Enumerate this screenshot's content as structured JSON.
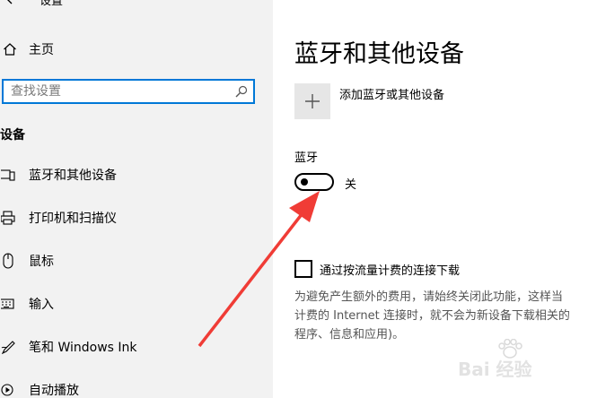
{
  "sidebar": {
    "header": "设置",
    "home_label": "主页",
    "search_placeholder": "查找设置",
    "section_title": "设备",
    "items": [
      {
        "label": "蓝牙和其他设备",
        "icon": "bluetooth-devices-icon"
      },
      {
        "label": "打印机和扫描仪",
        "icon": "printer-icon"
      },
      {
        "label": "鼠标",
        "icon": "mouse-icon"
      },
      {
        "label": "输入",
        "icon": "keyboard-icon"
      },
      {
        "label": "笔和 Windows Ink",
        "icon": "pen-icon"
      },
      {
        "label": "自动播放",
        "icon": "autoplay-icon"
      }
    ]
  },
  "main": {
    "title": "蓝牙和其他设备",
    "add_device_label": "添加蓝牙或其他设备",
    "bluetooth_label": "蓝牙",
    "bluetooth_state": "关",
    "metered_label": "通过按流量计费的连接下载",
    "metered_description": [
      "为避免产生额外的费用，请始终关闭此功能，这样当",
      "计费的 Internet 连接时，就不会为新设备下载相关的",
      "程序、信息和应用)。"
    ]
  },
  "watermark": {
    "text": "Bai 经验"
  },
  "colors": {
    "accent": "#0078d7",
    "sidebar_bg": "#f2f2f2",
    "arrow": "#f03c36"
  }
}
